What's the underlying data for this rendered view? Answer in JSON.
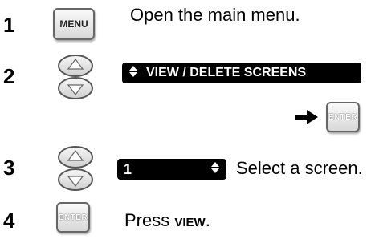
{
  "steps": [
    {
      "number": "1",
      "key": "MENU",
      "text": "Open the main menu."
    },
    {
      "number": "2",
      "menu_bar": "VIEW / DELETE SCREENS",
      "confirm_key": "ENTER"
    },
    {
      "number": "3",
      "selector_value": "1",
      "text": "Select a screen."
    },
    {
      "number": "4",
      "key": "ENTER",
      "text_prefix": "Press ",
      "text_key": "VIEW",
      "text_suffix": "."
    }
  ],
  "icons": {
    "updown": "up-down-rocker-icon",
    "arrow": "right-arrow-icon"
  }
}
